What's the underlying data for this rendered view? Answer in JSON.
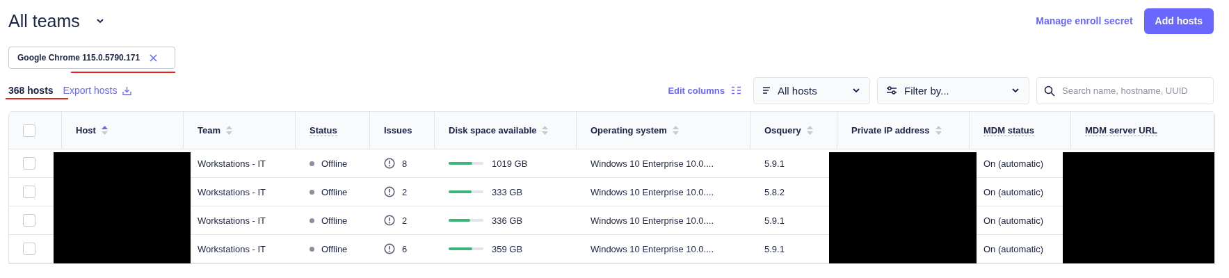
{
  "team_selector": {
    "label": "All teams"
  },
  "header_actions": {
    "link": "Manage enroll secret",
    "button": "Add hosts"
  },
  "filter_chip": {
    "label": "Google Chrome 115.0.5790.171",
    "annotated": true
  },
  "host_count": {
    "label": "368 hosts",
    "annotated": true
  },
  "export_link": {
    "label": "Export hosts"
  },
  "edit_columns": {
    "label": "Edit columns"
  },
  "status_dropdown": {
    "value": "All hosts"
  },
  "filter_dropdown": {
    "label": "Filter by..."
  },
  "search": {
    "placeholder": "Search name, hostname, UUID"
  },
  "table": {
    "select_all": {
      "checked": false
    },
    "columns": [
      {
        "label": "Host",
        "sortable": true,
        "sorted": true,
        "tooltip": false,
        "redacted": true
      },
      {
        "label": "Team",
        "sortable": true,
        "sorted": false,
        "tooltip": false,
        "redacted": false
      },
      {
        "label": "Status",
        "sortable": false,
        "tooltip": true,
        "redacted": false
      },
      {
        "label": "Issues",
        "sortable": false,
        "tooltip": false,
        "redacted": false
      },
      {
        "label": "Disk space available",
        "sortable": true,
        "sorted": false,
        "tooltip": false,
        "redacted": false
      },
      {
        "label": "Operating system",
        "sortable": true,
        "sorted": false,
        "tooltip": false,
        "redacted": false
      },
      {
        "label": "Osquery",
        "sortable": true,
        "sorted": false,
        "tooltip": false,
        "redacted": false
      },
      {
        "label": "Private IP address",
        "sortable": true,
        "sorted": false,
        "tooltip": false,
        "redacted": true
      },
      {
        "label": "MDM status",
        "sortable": false,
        "tooltip": true,
        "redacted": false
      },
      {
        "label": "MDM server URL",
        "sortable": false,
        "tooltip": true,
        "redacted": true
      }
    ],
    "rows": [
      {
        "selected": false,
        "team": "Workstations - IT",
        "status": "Offline",
        "issues": "8",
        "disk": "1019 GB",
        "level": 0.68,
        "os": "Windows 10 Enterprise 10.0....",
        "osquery": "5.9.1",
        "mdm_status": "On (automatic)"
      },
      {
        "selected": false,
        "team": "Workstations - IT",
        "status": "Offline",
        "issues": "2",
        "disk": "333 GB",
        "level": 0.65,
        "os": "Windows 10 Enterprise 10.0....",
        "osquery": "5.8.2",
        "mdm_status": "On (automatic)"
      },
      {
        "selected": false,
        "team": "Workstations - IT",
        "status": "Offline",
        "issues": "2",
        "disk": "336 GB",
        "level": 0.62,
        "os": "Windows 10 Enterprise 10.0....",
        "osquery": "5.9.1",
        "mdm_status": "On (automatic)"
      },
      {
        "selected": false,
        "team": "Workstations - IT",
        "status": "Offline",
        "issues": "6",
        "disk": "359 GB",
        "level": 0.68,
        "os": "Windows 10 Enterprise 10.0....",
        "osquery": "5.9.1",
        "mdm_status": "On (automatic)"
      }
    ]
  }
}
